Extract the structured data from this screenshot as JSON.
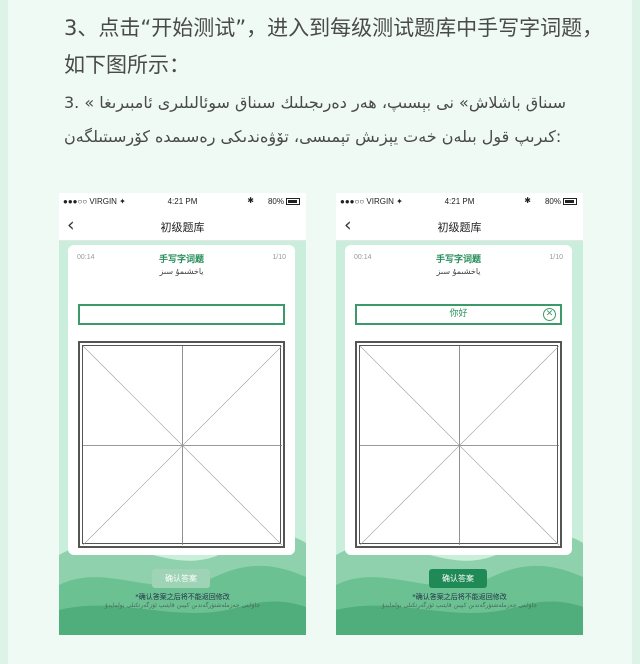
{
  "intro": {
    "zh": "3、点击“开始测试”，进入到每级测试题库中手写字词题，如下图所示：",
    "ug": "3. « سىناق باشلاش» نى بېسىپ، ھەر دەرىجىلىك سىناق سوئالىلىرى ئامبىرىغا كىرىپ قول بىلەن خەت يېزىش تېمىسى، تۆۋەندىكى رەسىمدە كۆرسىتىلگەن:"
  },
  "phones": [
    {
      "status": {
        "carrier": "●●●○○ VIRGIN ✦",
        "time": "4:21 PM",
        "bluetooth": "✱",
        "battery": "80%"
      },
      "nav": {
        "back_icon": "chevron-left-icon",
        "title": "初级题库"
      },
      "card": {
        "timer": "00:14",
        "question_type": "手写字词题",
        "counter": "1/10",
        "question": "ياخشىمۇ سىز",
        "answer": ""
      },
      "confirm": {
        "label": "确认答案",
        "state": "disabled"
      },
      "notice_zh": "*确认答案之后将不能返回修改",
      "notice_ug": "جاۋابنى جەزملەشتۈرگەندىن كېيىن قايتىپ ئۆزگەرتكىلى بولمايدۇ"
    },
    {
      "status": {
        "carrier": "●●●○○ VIRGIN ✦",
        "time": "4:21 PM",
        "bluetooth": "✱",
        "battery": "80%"
      },
      "nav": {
        "back_icon": "chevron-left-icon",
        "title": "初级题库"
      },
      "card": {
        "timer": "00:14",
        "question_type": "手写字词题",
        "counter": "1/10",
        "question": "ياخشىمۇ سىز",
        "answer": "你好"
      },
      "confirm": {
        "label": "确认答案",
        "state": "active"
      },
      "notice_zh": "*确认答案之后将不能返回修改",
      "notice_ug": "جاۋابنى جەزملەشتۈرگەندىن كېيىن قايتىپ ئۆزگەرتكىلى بولمايدۇ"
    }
  ],
  "colors": {
    "accent": "#1f8a55",
    "disabled": "#9ed3b6",
    "background": "#c9eedb"
  }
}
